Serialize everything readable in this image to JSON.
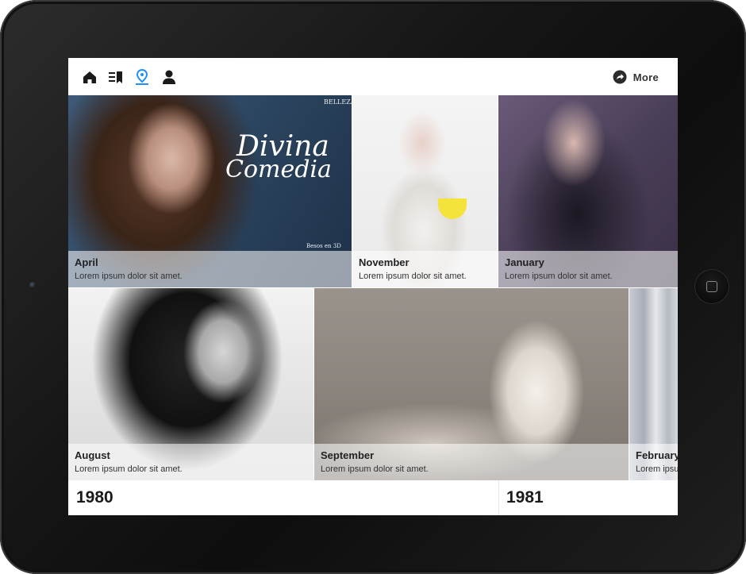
{
  "nav": {
    "icons": [
      "home-icon",
      "reading-list-icon",
      "location-pin-icon",
      "profile-icon"
    ],
    "active_color": "#1e90ff",
    "more_label": "More"
  },
  "tiles": [
    {
      "month": "April",
      "desc": "Lorem ipsum dolor sit amet."
    },
    {
      "month": "November",
      "desc": "Lorem ipsum dolor sit amet."
    },
    {
      "month": "January",
      "desc": "Lorem ipsum dolor sit amet."
    },
    {
      "month": "August",
      "desc": "Lorem ipsum dolor sit amet."
    },
    {
      "month": "September",
      "desc": "Lorem ipsum dolor sit amet."
    },
    {
      "month": "February",
      "desc": "Lorem ipsum dolor sit amet."
    }
  ],
  "magazine": {
    "section": "BELLEZA",
    "title_line1": "Divina",
    "title_line2": "Comedia",
    "caption": "Besos en 3D"
  },
  "years": [
    "1980",
    "1981"
  ]
}
